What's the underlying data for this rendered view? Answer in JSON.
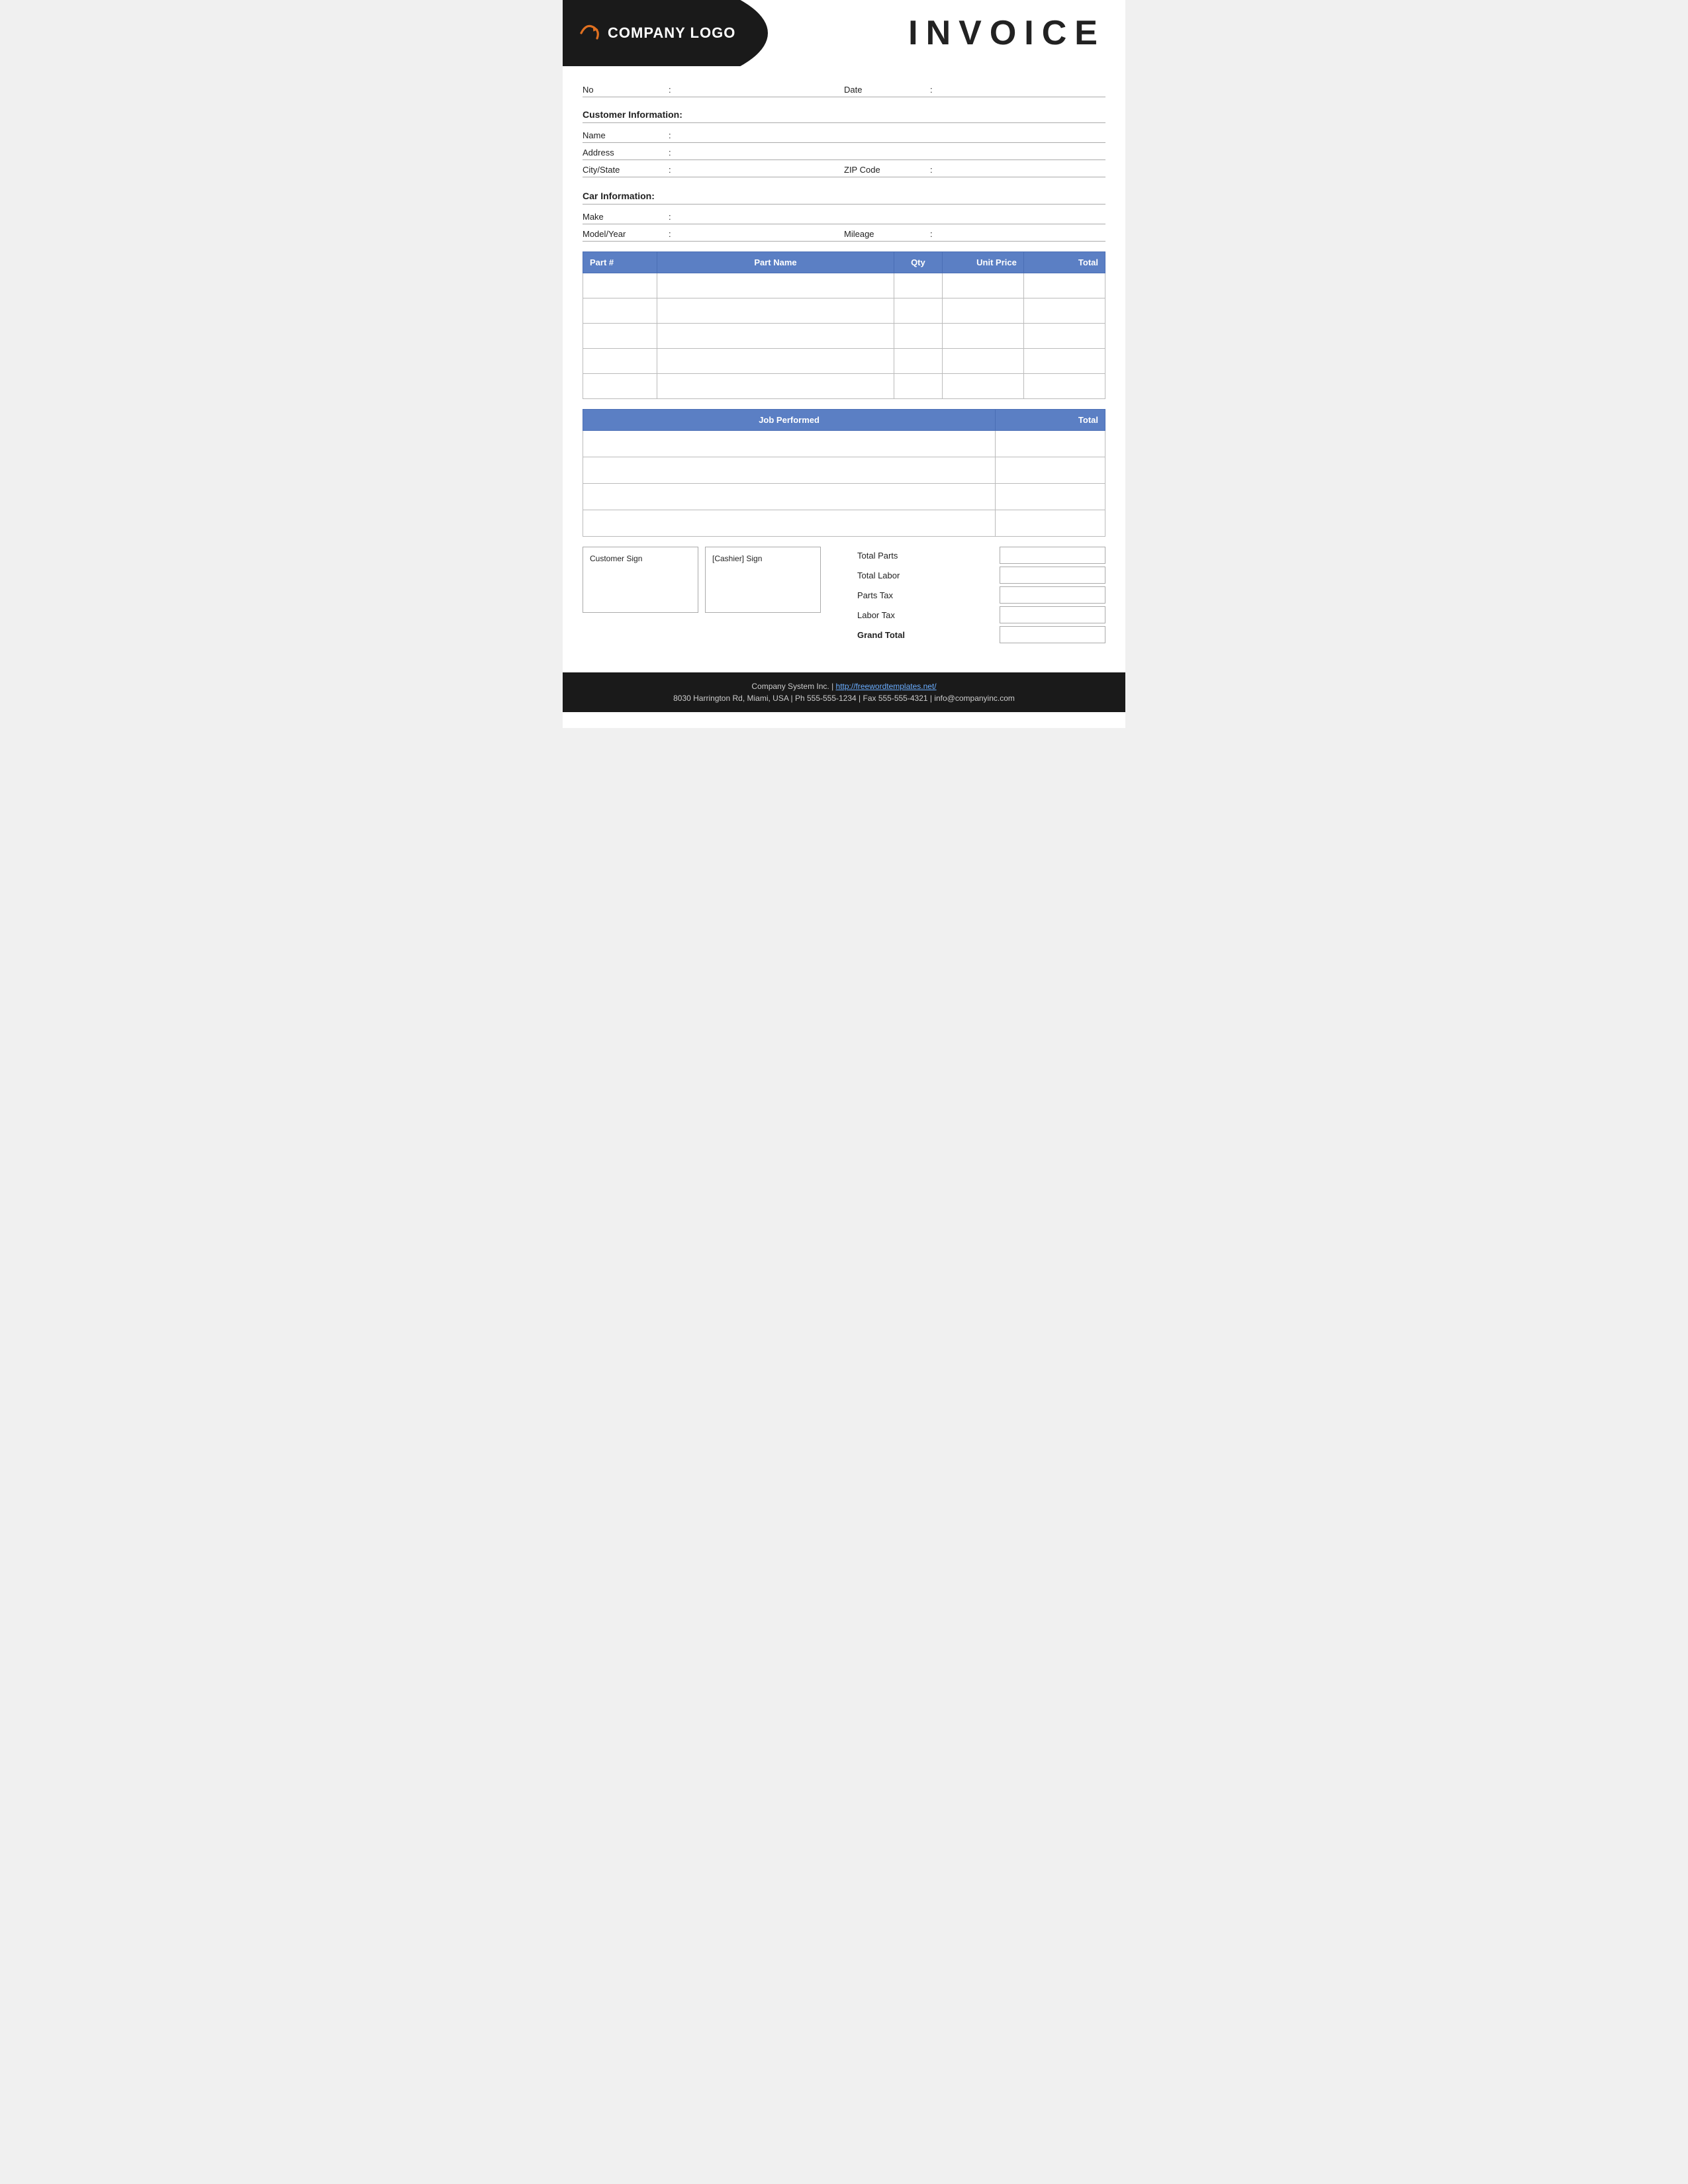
{
  "header": {
    "logo_text": "COMPANY LOGO",
    "invoice_title": "INVOICE"
  },
  "invoice_info": {
    "no_label": "No",
    "no_colon": ":",
    "date_label": "Date",
    "date_colon": ":"
  },
  "customer_section": {
    "title": "Customer Information:",
    "name_label": "Name",
    "name_colon": ":",
    "address_label": "Address",
    "address_colon": ":",
    "city_label": "City/State",
    "city_colon": ":",
    "zip_label": "ZIP Code",
    "zip_colon": ":"
  },
  "car_section": {
    "title": "Car Information:",
    "make_label": "Make",
    "make_colon": ":",
    "model_label": "Model/Year",
    "model_colon": ":",
    "mileage_label": "Mileage",
    "mileage_colon": ":"
  },
  "parts_table": {
    "col_part": "Part #",
    "col_name": "Part Name",
    "col_qty": "Qty",
    "col_price": "Unit Price",
    "col_total": "Total",
    "rows": [
      {
        "part": "",
        "name": "",
        "qty": "",
        "price": "",
        "total": ""
      },
      {
        "part": "",
        "name": "",
        "qty": "",
        "price": "",
        "total": ""
      },
      {
        "part": "",
        "name": "",
        "qty": "",
        "price": "",
        "total": ""
      },
      {
        "part": "",
        "name": "",
        "qty": "",
        "price": "",
        "total": ""
      },
      {
        "part": "",
        "name": "",
        "qty": "",
        "price": "",
        "total": ""
      }
    ]
  },
  "labor_table": {
    "col_job": "Job Performed",
    "col_total": "Total",
    "rows": [
      {
        "job": "",
        "total": ""
      },
      {
        "job": "",
        "total": ""
      },
      {
        "job": "",
        "total": ""
      },
      {
        "job": "",
        "total": ""
      }
    ]
  },
  "signatures": {
    "customer_label": "Customer Sign",
    "cashier_label": "[Cashier] Sign"
  },
  "totals": {
    "total_parts_label": "Total Parts",
    "total_labor_label": "Total Labor",
    "parts_tax_label": "Parts Tax",
    "labor_tax_label": "Labor Tax",
    "grand_total_label": "Grand Total"
  },
  "footer": {
    "line1_company": "Company System Inc.",
    "line1_separator": " | ",
    "line1_url": "http://freewordtemplates.net/",
    "line2": "8030 Harrington Rd, Miami, USA | Ph 555-555-1234 | Fax 555-555-4321 | info@companyinc.com"
  }
}
